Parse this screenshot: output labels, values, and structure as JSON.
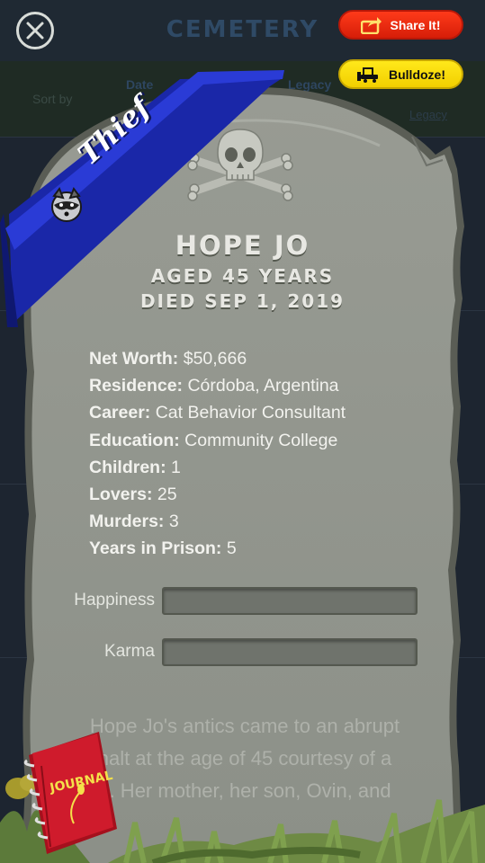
{
  "background": {
    "title": "CEMETERY",
    "sort_label": "Sort by",
    "tab_date": "Date",
    "tab_legacy": "Legacy",
    "link": "Legacy"
  },
  "close": {
    "icon": "close-icon"
  },
  "share_button": {
    "label": "Share It!",
    "icon": "share-icon",
    "color": "#f0360f"
  },
  "bulldoze_button": {
    "label": "Bulldoze!",
    "icon": "bulldozer-icon",
    "color": "#fbe000"
  },
  "ribbon": {
    "label": "Thief",
    "icon": "raccoon-icon",
    "color": "#1d2bb8"
  },
  "headstone": {
    "name": "HOPE JO",
    "age": "AGED 45 YEARS",
    "died": "DIED SEP 1, 2019"
  },
  "stats": [
    {
      "label": "Net Worth:",
      "value": "$50,666"
    },
    {
      "label": "Residence:",
      "value": "Córdoba, Argentina"
    },
    {
      "label": "Career:",
      "value": "Cat Behavior Consultant"
    },
    {
      "label": "Education:",
      "value": "Community College"
    },
    {
      "label": "Children:",
      "value": "1"
    },
    {
      "label": "Lovers:",
      "value": "25"
    },
    {
      "label": "Murders:",
      "value": "3"
    },
    {
      "label": "Years in Prison:",
      "value": "5"
    }
  ],
  "meters": {
    "happiness": {
      "label": "Happiness",
      "value": 0
    },
    "karma": {
      "label": "Karma",
      "value": 0
    }
  },
  "bio": {
    "line1": "Hope Jo's antics came to an abrupt",
    "line2": "halt at the age of 45 courtesy of a",
    "line3": "... Her mother, her son, Ovin, and"
  },
  "journal": {
    "label": "JOURNAL",
    "icon": "journal-icon",
    "color": "#c8182a"
  }
}
